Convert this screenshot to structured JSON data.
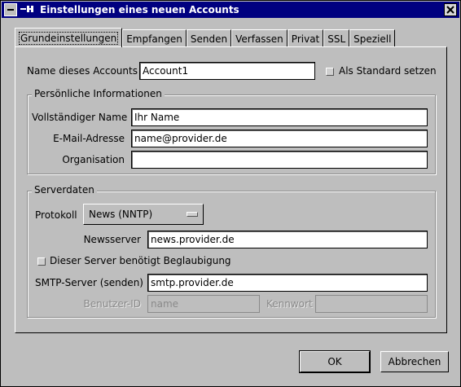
{
  "window": {
    "title": "Einstellungen eines neuen Accounts",
    "icon_glyph": "−",
    "sep_glyph": "—M"
  },
  "tabs": [
    {
      "label": "Grundeinstellungen",
      "active": true
    },
    {
      "label": "Empfangen"
    },
    {
      "label": "Senden"
    },
    {
      "label": "Verfassen"
    },
    {
      "label": "Privat"
    },
    {
      "label": "SSL"
    },
    {
      "label": "Speziell"
    }
  ],
  "account": {
    "name_label": "Name dieses Accounts",
    "name_value": "Account1",
    "default_label": "Als Standard setzen",
    "default_checked": false
  },
  "personal": {
    "title": "Persönliche Informationen",
    "fullname_label": "Vollständiger Name",
    "fullname_value": "Ihr Name",
    "email_label": "E-Mail-Adresse",
    "email_value": "name@provider.de",
    "org_label": "Organisation",
    "org_value": ""
  },
  "server": {
    "title": "Serverdaten",
    "protocol_label": "Protokoll",
    "protocol_value": "News (NNTP)",
    "newsserver_label": "Newsserver",
    "newsserver_value": "news.provider.de",
    "auth_label": "Dieser Server benötigt Beglaubigung",
    "auth_checked": false,
    "smtp_label": "SMTP-Server (senden)",
    "smtp_value": "smtp.provider.de",
    "userid_label": "Benutzer-ID",
    "userid_value": "name",
    "password_label": "Kennwort",
    "password_value": ""
  },
  "buttons": {
    "ok": "OK",
    "cancel": "Abbrechen"
  },
  "colors": {
    "titlebar": "#000080",
    "background": "#bebebe"
  }
}
